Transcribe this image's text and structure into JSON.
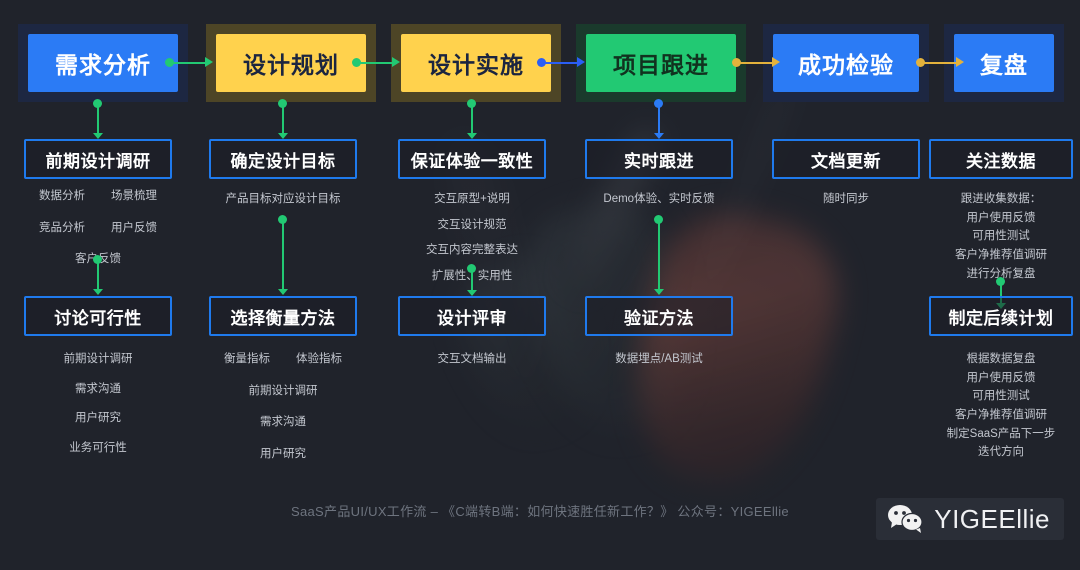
{
  "theme": {
    "background": "#20232b",
    "blue": "#2b7bf5",
    "yellow": "#ffd24d",
    "green": "#22c973",
    "border_blue": "#1f7aed",
    "note_text": "#c3c7cf",
    "caption_text": "#6e747f"
  },
  "stages": [
    {
      "label": "需求分析",
      "chip": "blue",
      "frame": "navy"
    },
    {
      "label": "设计规划",
      "chip": "yellow",
      "frame": "olive"
    },
    {
      "label": "设计实施",
      "chip": "yellow",
      "frame": "olive"
    },
    {
      "label": "项目跟进",
      "chip": "green",
      "frame": "dgreen"
    },
    {
      "label": "成功检验",
      "chip": "blue",
      "frame": "navy"
    },
    {
      "label": "复盘",
      "chip": "blue",
      "frame": "navy"
    }
  ],
  "stage_connectors": [
    {
      "color": "#22c973",
      "from": "需求分析",
      "to": "设计规划"
    },
    {
      "color": "#22c973",
      "from": "设计规划",
      "to": "设计实施"
    },
    {
      "color": "#2b5ef5",
      "from": "设计实施",
      "to": "项目跟进"
    },
    {
      "color": "#e3b23c",
      "from": "项目跟进",
      "to": "成功检验"
    },
    {
      "color": "#e3b23c",
      "from": "成功检验",
      "to": "复盘"
    }
  ],
  "columns": [
    {
      "stage": "需求分析",
      "step1": "前期设计调研",
      "notes1_pairs": [
        [
          "数据分析",
          "场景梳理"
        ],
        [
          "竞品分析",
          "用户反馈"
        ]
      ],
      "notes1_single": [
        "客户反馈"
      ],
      "step2": "讨论可行性",
      "notes2": [
        "前期设计调研",
        "需求沟通",
        "用户研究",
        "业务可行性"
      ]
    },
    {
      "stage": "设计规划",
      "step1": "确定设计目标",
      "notes1_pairs": [],
      "notes1_single": [
        "产品目标对应设计目标"
      ],
      "step2": "选择衡量方法",
      "notes2_pairs": [
        [
          "衡量指标",
          "体验指标"
        ]
      ],
      "notes2": [
        "前期设计调研",
        "需求沟通",
        "用户研究"
      ]
    },
    {
      "stage": "设计实施",
      "step1": "保证体验一致性",
      "notes1_single": [
        "交互原型+说明",
        "交互设计规范",
        "交互内容完整表达",
        "扩展性、实用性"
      ],
      "step2": "设计评审",
      "notes2": [
        "交互文档输出"
      ]
    },
    {
      "stage": "项目跟进",
      "step1": "实时跟进",
      "notes1_single": [
        "Demo体验、实时反馈"
      ],
      "step2": "验证方法",
      "notes2": [
        "数据埋点/AB测试"
      ]
    },
    {
      "stage": "成功检验",
      "step1": "文档更新",
      "notes1_single": [
        "随时同步"
      ],
      "step2": null,
      "notes2": []
    },
    {
      "stage": "复盘",
      "step1": "关注数据",
      "notes1_single": [
        "跟进收集数据：",
        "用户使用反馈",
        "可用性测试",
        "客户净推荐值调研",
        "进行分析复盘"
      ],
      "step2": "制定后续计划",
      "notes2": [
        "根据数据复盘",
        "用户使用反馈",
        "可用性测试",
        "客户净推荐值调研",
        "制定SaaS产品下一步",
        "迭代方向"
      ]
    }
  ],
  "footer": {
    "caption": "SaaS产品UI/UX工作流 – 《C端转B端：如何快速胜任新工作？》 公众号：YIGEEllie",
    "watermark_label": "YIGEEllie",
    "watermark_icon": "wechat-icon"
  }
}
